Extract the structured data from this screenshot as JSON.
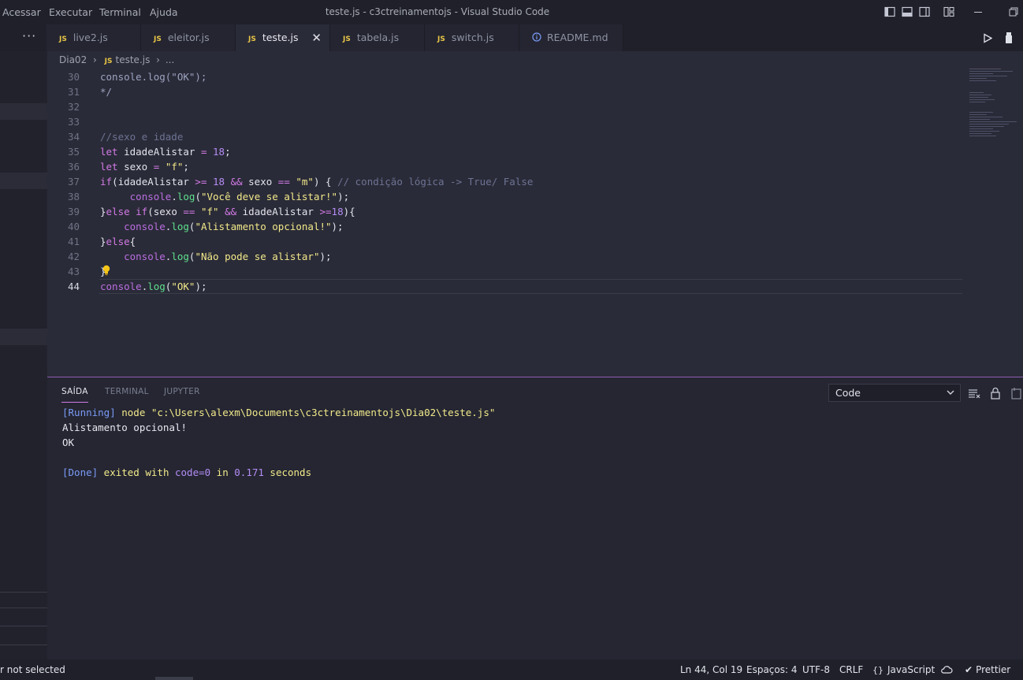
{
  "titlebar": {
    "menus": [
      "Acessar",
      "Executar",
      "Terminal",
      "Ajuda"
    ],
    "title": "teste.js - c3ctreinamentojs - Visual Studio Code"
  },
  "tabs": [
    {
      "label": "live2.js",
      "type": "js"
    },
    {
      "label": "eleitor.js",
      "type": "js"
    },
    {
      "label": "teste.js",
      "type": "js",
      "active": true
    },
    {
      "label": "tabela.js",
      "type": "js"
    },
    {
      "label": "switch.js",
      "type": "js"
    },
    {
      "label": "README.md",
      "type": "info"
    }
  ],
  "tabbar": {
    "more": "···",
    "js_badge": "JS",
    "close": "✕"
  },
  "breadcrumb": {
    "folder": "Dia02",
    "sep": "›",
    "file": "teste.js",
    "more": "..."
  },
  "editor": {
    "line_numbers": [
      "30",
      "31",
      "32",
      "33",
      "34",
      "35",
      "36",
      "37",
      "38",
      "39",
      "40",
      "41",
      "42",
      "43",
      "44"
    ],
    "current_line": "44"
  },
  "panel": {
    "tabs": [
      "SAÍDA",
      "TERMINAL",
      "JUPYTER"
    ],
    "select_value": "Code",
    "output": {
      "running_tag": "[Running]",
      "running_cmd": " node \"c:\\Users\\alexm\\Documents\\c3ctreinamentojs\\Dia02\\teste.js\"",
      "line2": "Alistamento opcional!",
      "line3": "OK",
      "done_tag": "[Done]",
      "done_text1": " exited with ",
      "done_code": "code=0",
      "done_text2": " in ",
      "done_time": "0.171",
      "done_text3": " seconds"
    }
  },
  "statusbar": {
    "left": "r not selected",
    "position": "Ln 44, Col 19",
    "spaces": "Espaços: 4",
    "encoding": "UTF-8",
    "eol": "CRLF",
    "language": "JavaScript",
    "prettier": "Prettier"
  },
  "colors": {
    "accent": "#d27ae6",
    "background": "#2a2b38",
    "string": "#f2e98a",
    "function": "#5ee08d"
  }
}
